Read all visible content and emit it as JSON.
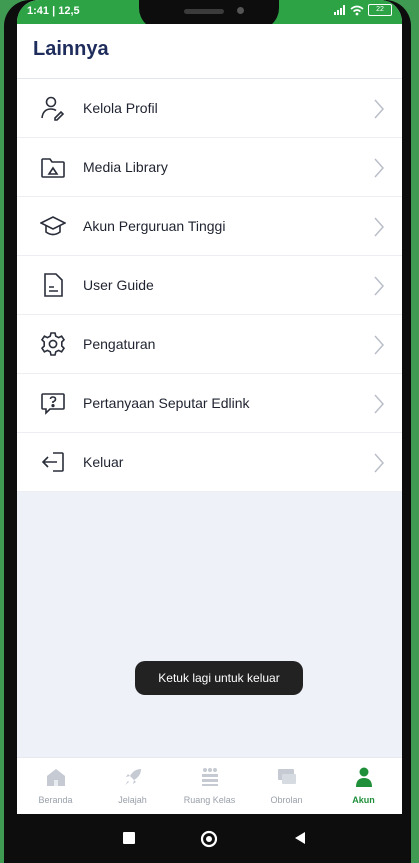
{
  "status": {
    "time": "1:41 | 12,5",
    "battery": "22"
  },
  "header": {
    "title": "Lainnya"
  },
  "menu": [
    {
      "label": "Kelola Profil",
      "icon": "user-edit-icon"
    },
    {
      "label": "Media Library",
      "icon": "folder-icon"
    },
    {
      "label": "Akun Perguruan Tinggi",
      "icon": "graduation-cap-icon"
    },
    {
      "label": "User Guide",
      "icon": "document-icon"
    },
    {
      "label": "Pengaturan",
      "icon": "gear-icon"
    },
    {
      "label": "Pertanyaan Seputar Edlink",
      "icon": "question-chat-icon"
    },
    {
      "label": "Keluar",
      "icon": "logout-icon"
    }
  ],
  "toast": {
    "text": "Ketuk lagi untuk keluar"
  },
  "nav": {
    "items": [
      {
        "label": "Beranda",
        "icon": "home-icon"
      },
      {
        "label": "Jelajah",
        "icon": "rocket-icon"
      },
      {
        "label": "Ruang Kelas",
        "icon": "classroom-icon"
      },
      {
        "label": "Obrolan",
        "icon": "chat-icon"
      },
      {
        "label": "Akun",
        "icon": "account-icon"
      }
    ],
    "active": "Akun"
  },
  "colors": {
    "accent": "#2da346",
    "title": "#1f2d5c",
    "toast_bg": "#222222"
  }
}
